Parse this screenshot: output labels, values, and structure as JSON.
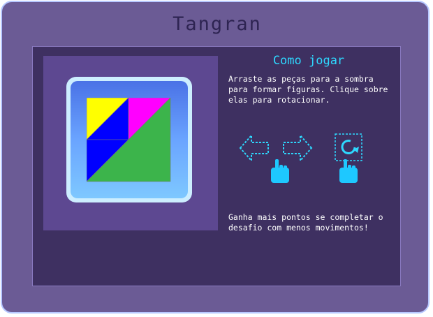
{
  "title": "Tangran",
  "help": {
    "heading": "Como jogar",
    "instructions": "Arraste as peças para a sombra para formar figuras. Clique sobre elas para rotacionar.",
    "scoring": "Ganha mais pontos se completar o desafio com menos movimentos!"
  },
  "colors": {
    "frame_bg": "#6b5b95",
    "panel_bg": "#3e3061",
    "accent": "#2ed8ff",
    "piece_yellow": "#ffff00",
    "piece_magenta": "#ff00ff",
    "piece_blue": "#0000ff",
    "piece_green": "#3cb44b"
  },
  "icons": [
    "arrow-left-icon",
    "arrow-right-icon",
    "rotate-icon",
    "pointing-hand-icon"
  ]
}
